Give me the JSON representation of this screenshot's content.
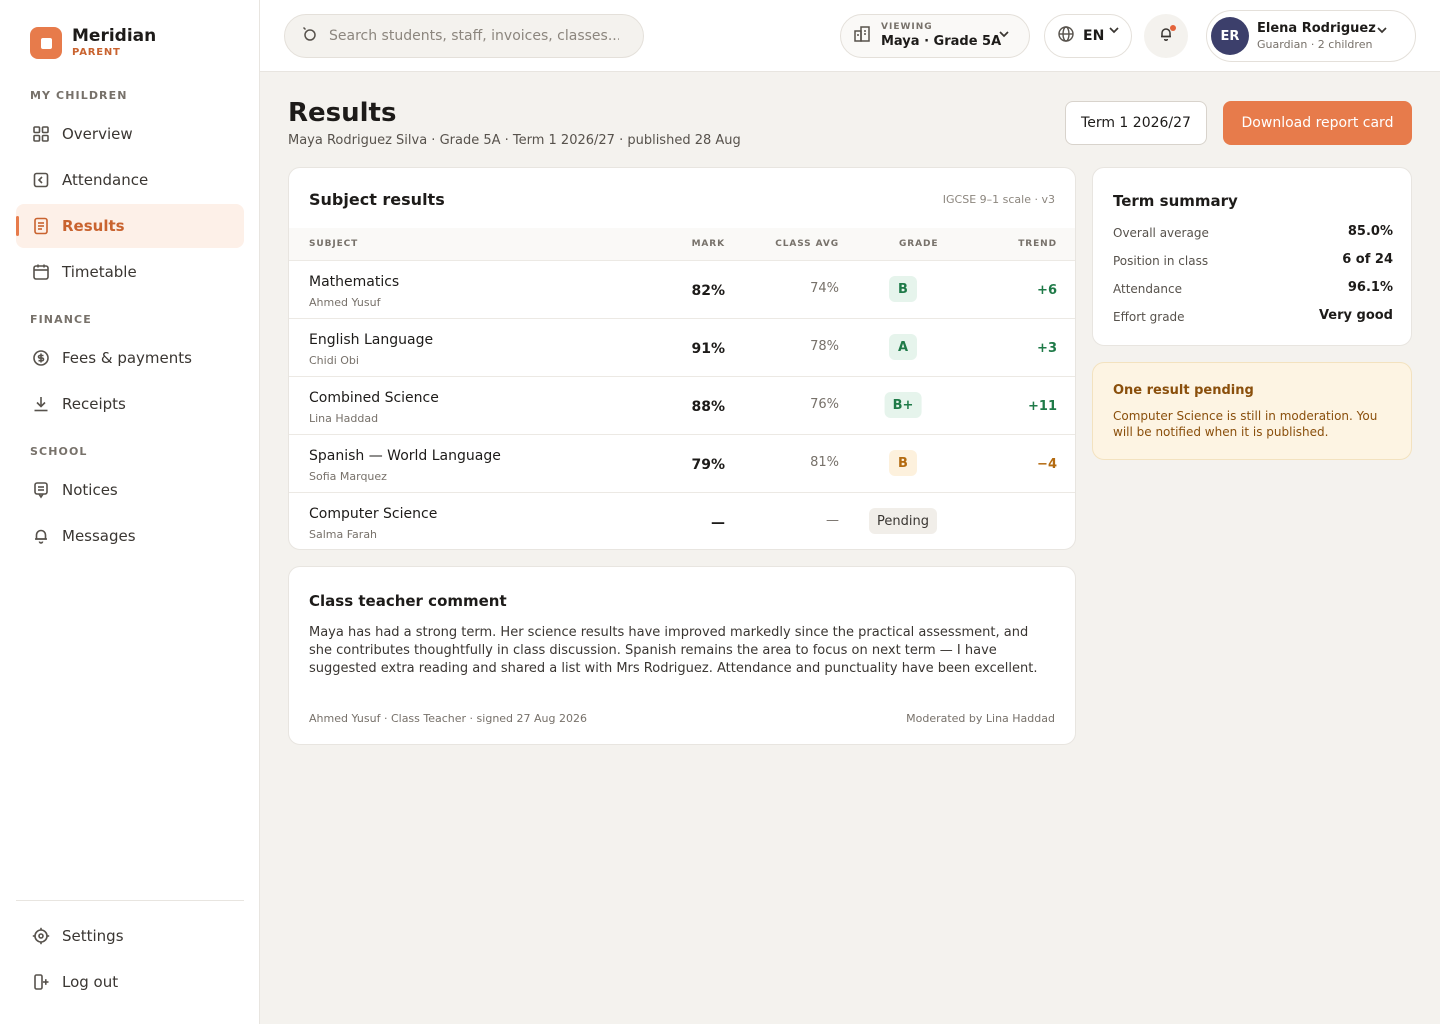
{
  "brand": {
    "name": "Meridian",
    "role": "PARENT"
  },
  "sidebar": {
    "sections": [
      {
        "label": "MY CHILDREN"
      },
      {
        "label": "FINANCE"
      },
      {
        "label": "SCHOOL"
      }
    ],
    "items": [
      {
        "label": "Overview",
        "icon": "grid-icon"
      },
      {
        "label": "Attendance",
        "icon": "calendar-check-icon"
      },
      {
        "label": "Results",
        "icon": "document-icon",
        "active": true
      },
      {
        "label": "Timetable",
        "icon": "calendar-icon"
      },
      {
        "label": "Fees & payments",
        "icon": "coin-icon"
      },
      {
        "label": "Receipts",
        "icon": "download-icon"
      },
      {
        "label": "Notices",
        "icon": "notice-icon"
      },
      {
        "label": "Messages",
        "icon": "bell-icon"
      }
    ],
    "footer": [
      {
        "label": "Settings",
        "icon": "settings-icon"
      },
      {
        "label": "Log out",
        "icon": "logout-icon"
      }
    ]
  },
  "topbar": {
    "search_placeholder": "Search students, staff, invoices, classes...",
    "viewing_label": "VIEWING",
    "viewing_value": "Maya · Grade 5A",
    "language": "EN",
    "user": {
      "initials": "ER",
      "name": "Elena Rodriguez",
      "sub": "Guardian · 2 children"
    }
  },
  "page": {
    "title": "Results",
    "subtitle": "Maya Rodriguez Silva · Grade 5A · Term 1 2026/27 · published 28 Aug",
    "term_button": "Term 1 2026/27",
    "download_button": "Download report card"
  },
  "results": {
    "title": "Subject results",
    "scale": "IGCSE 9–1 scale · v3",
    "headers": {
      "subject": "SUBJECT",
      "mark": "MARK",
      "avg": "CLASS AVG",
      "grade": "GRADE",
      "trend": "TREND"
    },
    "rows": [
      {
        "subject": "Mathematics",
        "teacher": "Ahmed Yusuf",
        "mark": "82%",
        "avg": "74%",
        "grade": "B",
        "trend": "+6"
      },
      {
        "subject": "English Language",
        "teacher": "Chidi Obi",
        "mark": "91%",
        "avg": "78%",
        "grade": "A",
        "trend": "+3"
      },
      {
        "subject": "Combined Science",
        "teacher": "Lina Haddad",
        "mark": "88%",
        "avg": "76%",
        "grade": "B+",
        "trend": "+11"
      },
      {
        "subject": "Spanish — World Language",
        "teacher": "Sofia Marquez",
        "mark": "79%",
        "avg": "81%",
        "grade": "B",
        "trend": "−4"
      },
      {
        "subject": "Computer Science",
        "teacher": "Salma Farah",
        "mark": "—",
        "avg": "—",
        "grade": "Pending",
        "trend": ""
      }
    ]
  },
  "comment": {
    "title": "Class teacher comment",
    "body": "Maya has had a strong term. Her science results have improved markedly since the practical assessment, and she contributes thoughtfully in class discussion. Spanish remains the area to focus on next term — I have suggested extra reading and shared a list with Mrs Rodriguez. Attendance and punctuality have been excellent.",
    "signed": "Ahmed Yusuf · Class Teacher · signed 27 Aug 2026",
    "moderated": "Moderated by Lina Haddad"
  },
  "summary": {
    "title": "Term summary",
    "rows": [
      {
        "label": "Overall average",
        "value": "85.0%"
      },
      {
        "label": "Position in class",
        "value": "6 of 24"
      },
      {
        "label": "Attendance",
        "value": "96.1%"
      },
      {
        "label": "Effort grade",
        "value": "Very good"
      }
    ]
  },
  "pending": {
    "title": "One result pending",
    "body": "Computer Science is still in moderation. You will be notified when it is published."
  },
  "colors": {
    "accent": "#e77b4b",
    "grade_good": "#1f7a48",
    "grade_warn": "#b36a10"
  }
}
